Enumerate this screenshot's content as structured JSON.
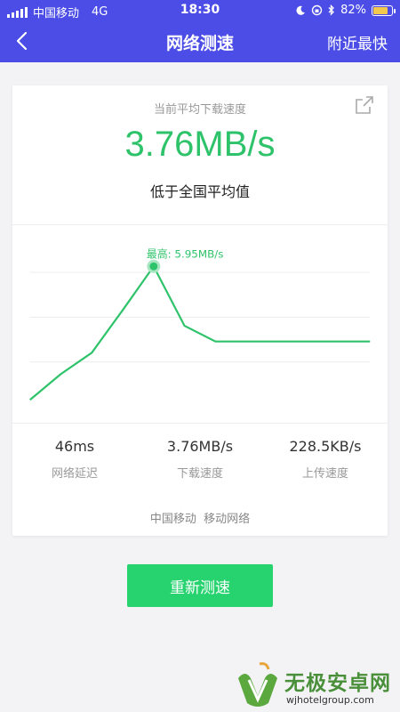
{
  "status_bar": {
    "carrier": "中国移动",
    "network": "4G",
    "time": "18:30",
    "battery": "82%",
    "battery_level": 0.82
  },
  "nav": {
    "title": "网络测速",
    "right_action": "附近最快"
  },
  "result": {
    "subtitle": "当前平均下载速度",
    "speed": "3.76MB/s",
    "comparison": "低于全国平均值"
  },
  "chart_data": {
    "type": "line",
    "y_unit": "MB/s",
    "peak_label": "最高: 5.95MB/s",
    "series": [
      {
        "values": [
          0.0,
          1.15,
          2.1,
          4.0,
          5.95,
          3.3,
          2.6,
          2.6,
          2.6,
          2.6,
          2.6,
          2.6
        ]
      }
    ],
    "ylim": [
      0,
      7.0
    ],
    "grid": true,
    "line_color": "#2ec36a"
  },
  "stats": [
    {
      "value": "46ms",
      "label": "网络延迟"
    },
    {
      "value": "3.76MB/s",
      "label": "下载速度"
    },
    {
      "value": "228.5KB/s",
      "label": "上传速度"
    }
  ],
  "carrier_info": "中国移动  移动网络",
  "retest_button": "重新测速",
  "watermark": {
    "title": "无极安卓网",
    "url": "wjhotelgroup.com"
  },
  "colors": {
    "nav_bg": "#4b4de6",
    "accent_green": "#2ec36a",
    "button_green": "#26d36f"
  }
}
